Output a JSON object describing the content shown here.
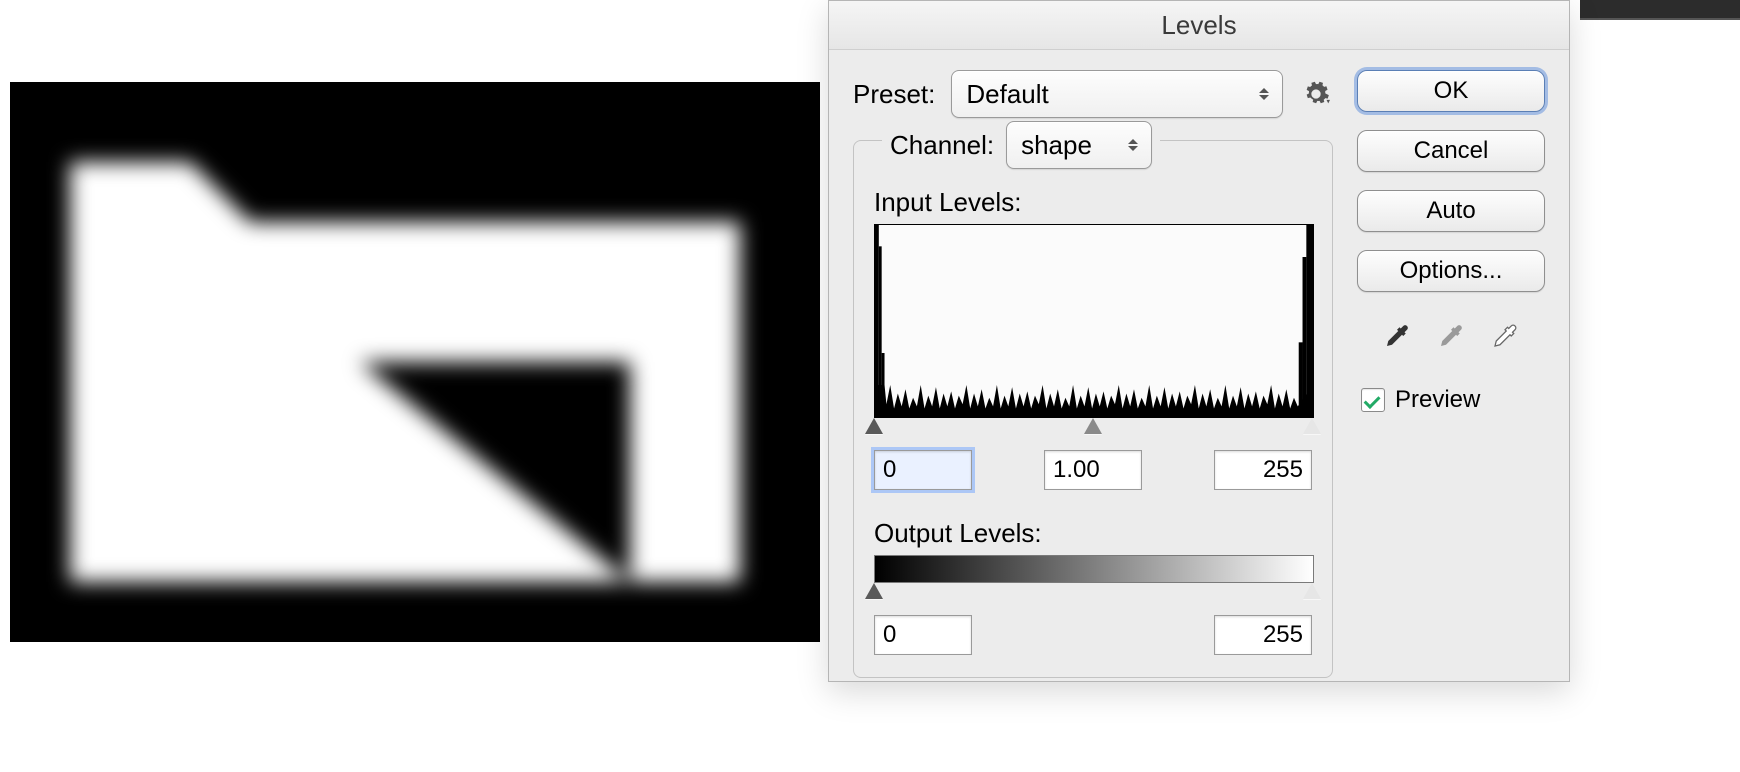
{
  "dialog": {
    "title": "Levels",
    "preset_label": "Preset:",
    "preset_value": "Default",
    "channel_label": "Channel:",
    "channel_value": "shape",
    "input_levels_label": "Input Levels:",
    "output_levels_label": "Output Levels:",
    "input": {
      "black": "0",
      "gamma": "1.00",
      "white": "255"
    },
    "output": {
      "black": "0",
      "white": "255"
    }
  },
  "buttons": {
    "ok": "OK",
    "cancel": "Cancel",
    "auto": "Auto",
    "options": "Options..."
  },
  "samplers": {
    "black": "Set Black Point",
    "gray": "Set Gray Point",
    "white": "Set White Point"
  },
  "preview": {
    "label": "Preview",
    "checked": true
  },
  "colors": {
    "dialog_bg": "#ececec",
    "focus_ring": "rgba(90,140,220,.5)"
  }
}
